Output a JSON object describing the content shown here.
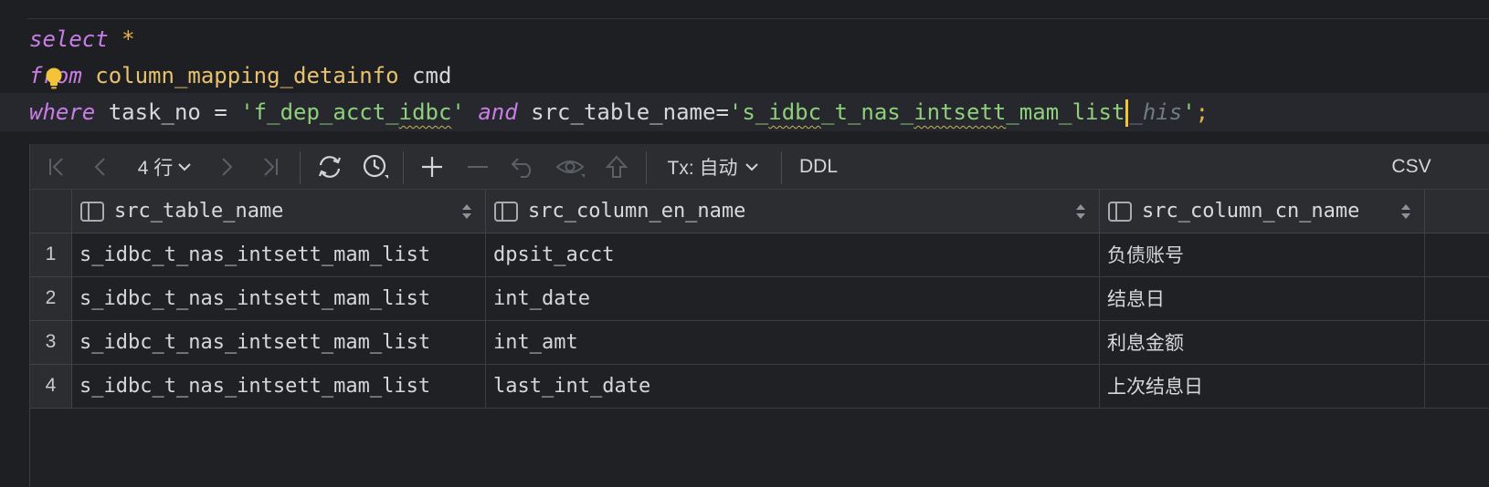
{
  "editor": {
    "line1": {
      "kw": "select",
      "star": "*"
    },
    "line2": {
      "kw": "from",
      "table": "column_mapping_detainfo",
      "alias": "cmd"
    },
    "line3": {
      "kw_where": "where",
      "col1": "task_no",
      "op1": "=",
      "val1_q1": "'",
      "val1_a": "f_dep_acct_",
      "val1_b": "idbc",
      "val1_q2": "'",
      "kw_and": "and",
      "col2": "src_table_name",
      "op2": "=",
      "val2_q1": "'",
      "val2_a": "s_",
      "val2_b": "idbc",
      "val2_c": "_t_nas_",
      "val2_d": "intsett",
      "val2_e": "_mam_list",
      "completion_hint": "_his",
      "val2_q2": "'",
      "semicolon": ";"
    }
  },
  "toolbar": {
    "rows_label": "4 行",
    "tx_label": "Tx: 自动",
    "ddl_label": "DDL",
    "csv_label": "CSV"
  },
  "table": {
    "columns": [
      "src_table_name",
      "src_column_en_name",
      "src_column_cn_name"
    ],
    "rows": [
      {
        "num": "1",
        "cells": [
          "s_idbc_t_nas_intsett_mam_list",
          "dpsit_acct",
          "负债账号"
        ]
      },
      {
        "num": "2",
        "cells": [
          "s_idbc_t_nas_intsett_mam_list",
          "int_date",
          "结息日"
        ]
      },
      {
        "num": "3",
        "cells": [
          "s_idbc_t_nas_intsett_mam_list",
          "int_amt",
          "利息金额"
        ]
      },
      {
        "num": "4",
        "cells": [
          "s_idbc_t_nas_intsett_mam_list",
          "last_int_date",
          "上次结息日"
        ]
      }
    ]
  }
}
